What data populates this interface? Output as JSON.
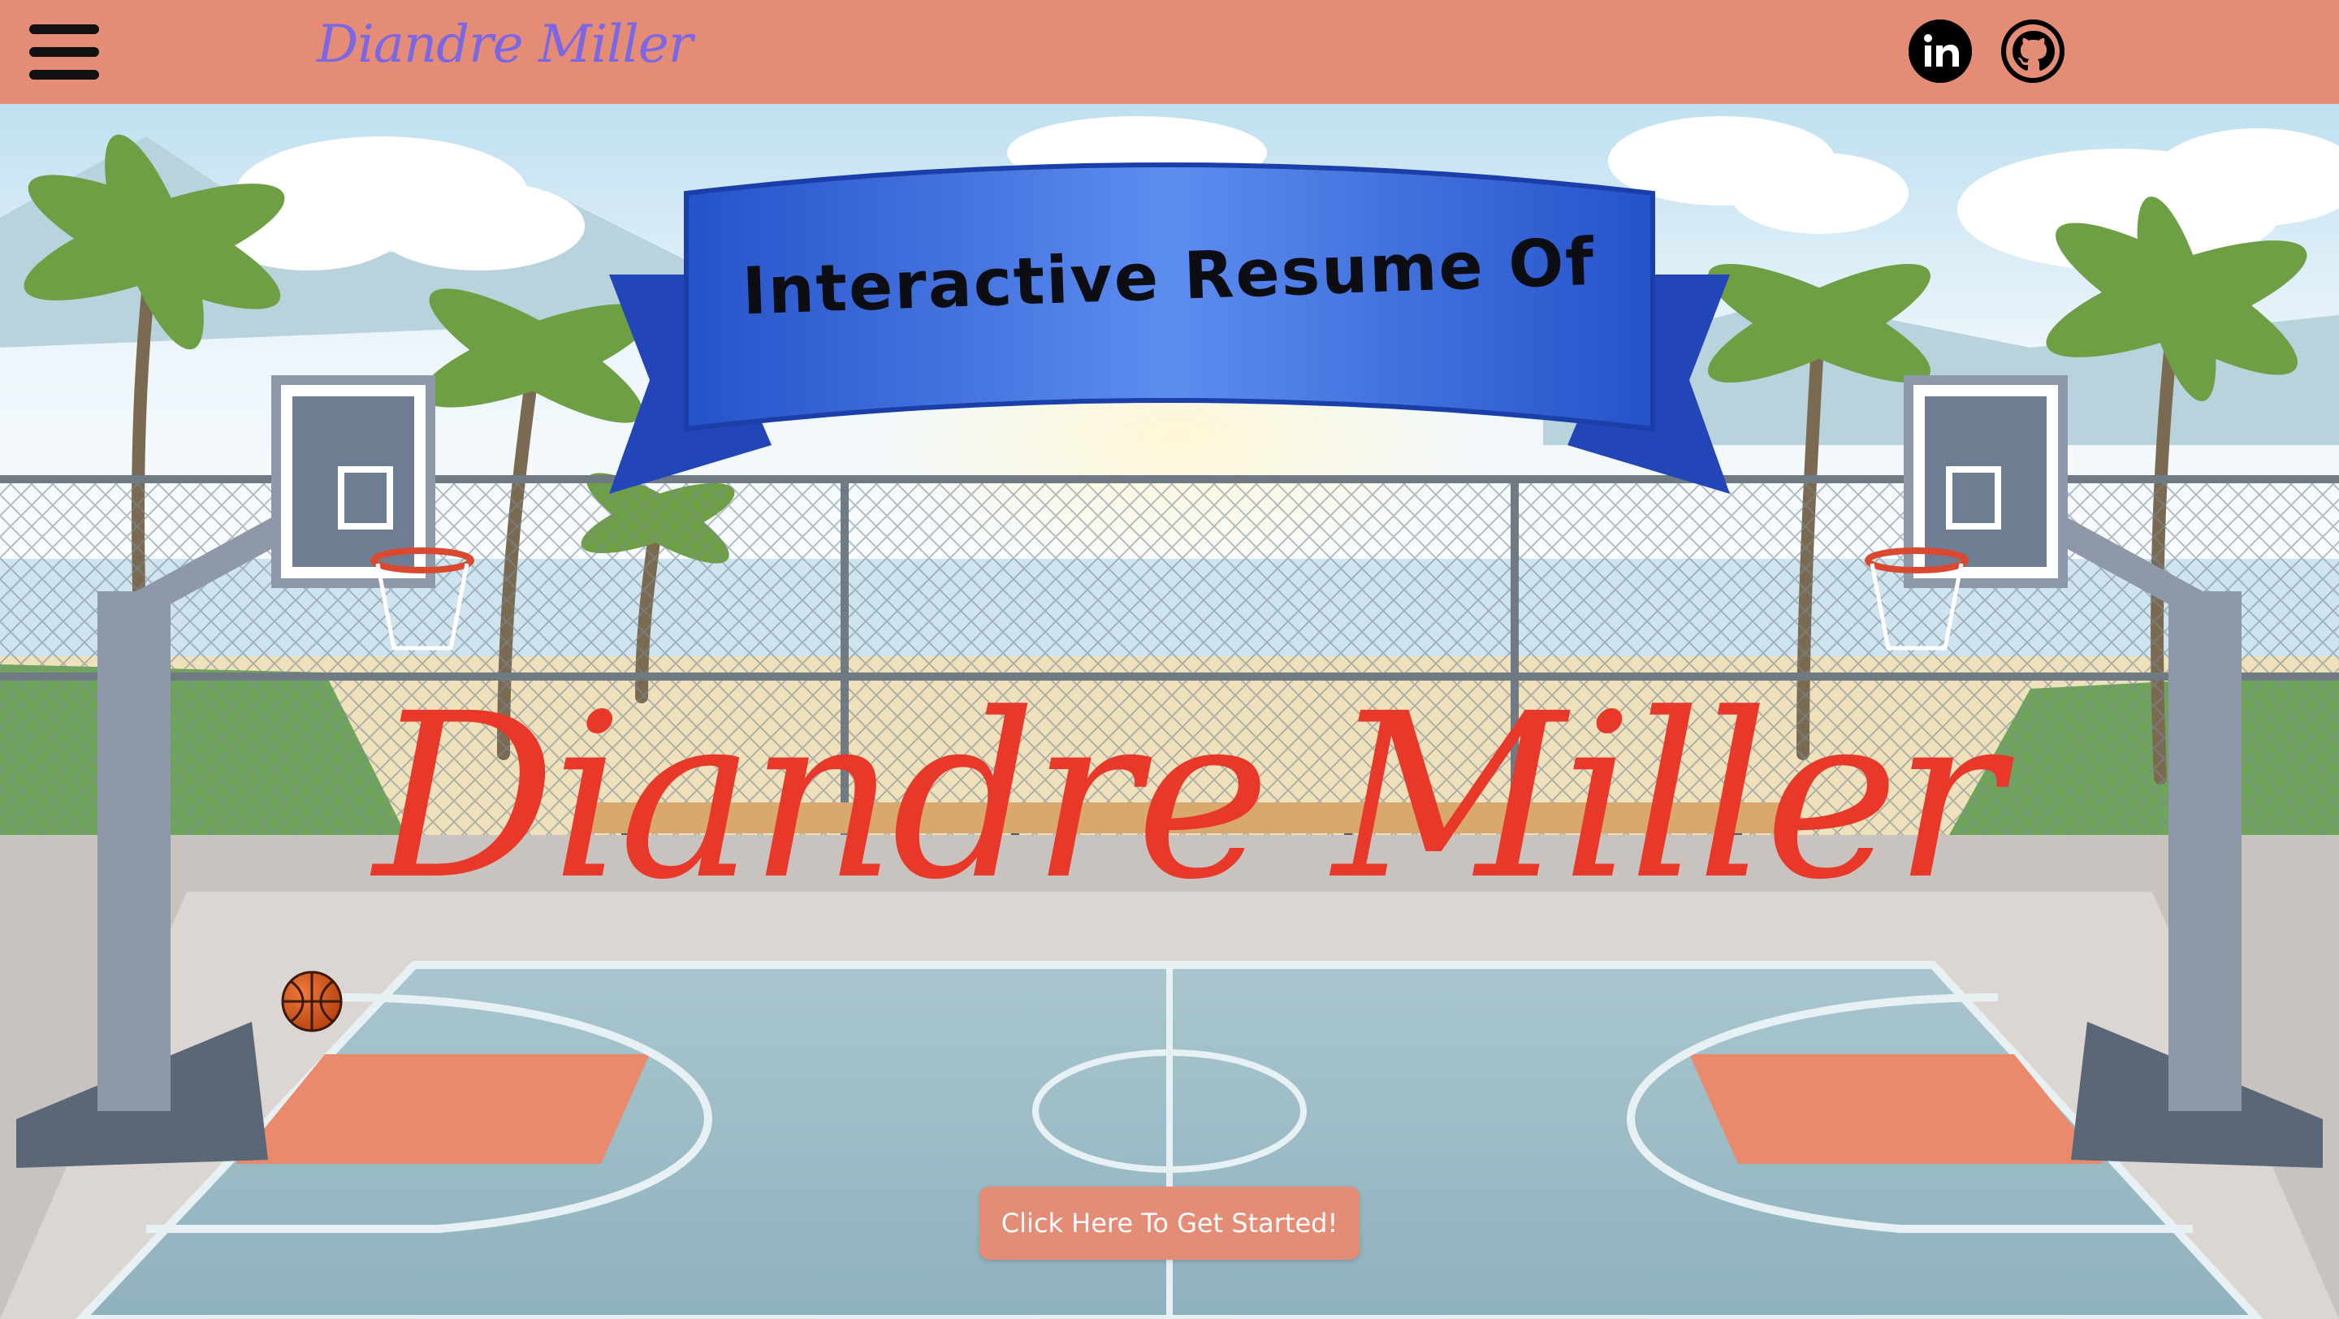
{
  "navbar": {
    "brand": "Diandre Miller",
    "menu_icon": "hamburger-menu-icon",
    "social": [
      {
        "icon": "linkedin-icon",
        "label": "in"
      },
      {
        "icon": "github-icon"
      }
    ]
  },
  "hero": {
    "banner_text": "Interactive Resume Of",
    "name": "Diandre Miller",
    "cta_label": "Click Here To Get Started!",
    "background_icon": "basketball-court-illustration",
    "ball_icon": "basketball-icon"
  },
  "colors": {
    "nav_bg": "#e58c77",
    "brand": "#7b66e3",
    "ribbon": "#2f5fd8",
    "name": "#e8382a",
    "cta_bg": "#e58c77"
  }
}
